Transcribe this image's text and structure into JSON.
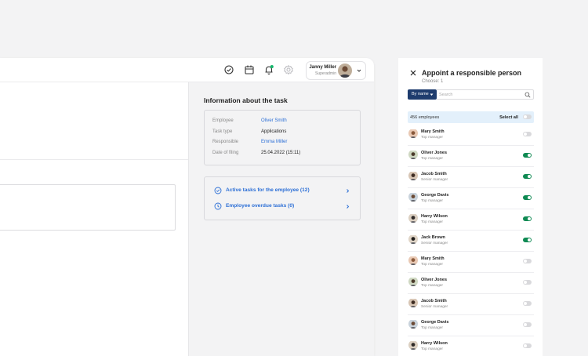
{
  "header": {
    "user": {
      "name": "Janny Miller",
      "role": "Superadmin"
    }
  },
  "info": {
    "title": "Information about the task",
    "rows": [
      {
        "label": "Employee",
        "value": "Oliver Smith"
      },
      {
        "label": "Task type",
        "value": "Applications"
      },
      {
        "label": "Responsible",
        "value": "Emma Miller"
      },
      {
        "label": "Date of filing",
        "value": "25.04.2022 (15:11)"
      }
    ],
    "links": [
      {
        "label": "Active tasks for the employee (12)"
      },
      {
        "label": "Employee overdue tasks (0)"
      }
    ]
  },
  "panel": {
    "title": "Appoint a responsible person",
    "subtitle": "Choose: 1",
    "filter_label": "By name",
    "search_placeholder": "Search",
    "count": "456 employees",
    "select_all": "Select all",
    "employees": [
      {
        "name": "Mary Smith",
        "role": "Top manager",
        "selected": false
      },
      {
        "name": "Oliver Jones",
        "role": "Top manager",
        "selected": true
      },
      {
        "name": "Jacob Smith",
        "role": "Senior manager",
        "selected": true
      },
      {
        "name": "George Davis",
        "role": "Top manager",
        "selected": true
      },
      {
        "name": "Harry Wilson",
        "role": "Top manager",
        "selected": true
      },
      {
        "name": "Jack Brown",
        "role": "Senior manager",
        "selected": true
      },
      {
        "name": "Mary Smith",
        "role": "Top manager",
        "selected": false
      },
      {
        "name": "Oliver Jones",
        "role": "Top manager",
        "selected": false
      },
      {
        "name": "Jacob Smith",
        "role": "Senior manager",
        "selected": false
      },
      {
        "name": "George Davis",
        "role": "Top manager",
        "selected": false
      },
      {
        "name": "Harry Wilson",
        "role": "Top manager",
        "selected": false
      }
    ]
  },
  "colors": {
    "accent": "#2c6fd6",
    "toggle_on": "#0f8a53",
    "filter_bg": "#1e3c6e",
    "notification_dot": "#12b76a"
  }
}
